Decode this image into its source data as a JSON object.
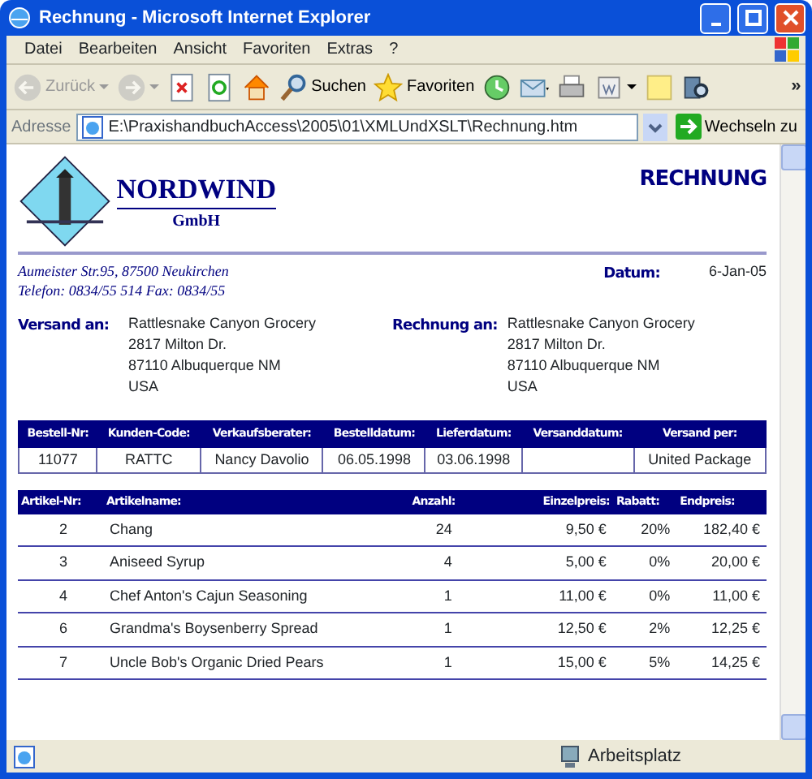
{
  "window": {
    "title": "Rechnung - Microsoft Internet Explorer"
  },
  "menu": [
    "Datei",
    "Bearbeiten",
    "Ansicht",
    "Favoriten",
    "Extras",
    "?"
  ],
  "toolbar": [
    {
      "kind": "back",
      "label": "Zurück",
      "disabled": true
    },
    {
      "kind": "forward",
      "disabled": true
    },
    {
      "kind": "stop",
      "disabled": false
    },
    {
      "kind": "refresh",
      "disabled": false
    },
    {
      "kind": "home",
      "disabled": false
    },
    {
      "kind": "search",
      "label": "Suchen",
      "disabled": false
    },
    {
      "kind": "favorites",
      "label": "Favoriten",
      "disabled": false
    },
    {
      "kind": "history",
      "disabled": false
    },
    {
      "kind": "mail",
      "disabled": false
    },
    {
      "kind": "print",
      "disabled": false
    },
    {
      "kind": "edit",
      "disabled": false
    },
    {
      "kind": "note",
      "disabled": false
    },
    {
      "kind": "research",
      "disabled": false
    }
  ],
  "toolbar_more": "»",
  "address": {
    "label": "Adresse",
    "url": "E:\\PraxishandbuchAccess\\2005\\01\\XMLUndXSLT\\Rechnung.htm",
    "go": "Wechseln zu"
  },
  "invoice": {
    "company": "NORDWIND",
    "company_suffix": "GmbH",
    "heading": "RECHNUNG",
    "sender_lines": [
      "Aumeister Str.95, 87500 Neukirchen",
      "Telefon:  0834/55 514 Fax:  0834/55"
    ],
    "date_label": "Datum:",
    "date": "6-Jan-05",
    "ship_to": {
      "label": "Versand an:",
      "lines": [
        "Rattlesnake Canyon Grocery",
        "2817 Milton Dr.",
        "87110 Albuquerque NM",
        "USA"
      ]
    },
    "bill_to": {
      "label": "Rechnung an:",
      "lines": [
        "Rattlesnake Canyon Grocery",
        "2817 Milton Dr.",
        "87110 Albuquerque NM",
        "USA"
      ]
    },
    "order_table": {
      "columns": [
        "Bestell-Nr:",
        "Kunden-Code:",
        "Verkaufsberater:",
        "Bestelldatum:",
        "Lieferdatum:",
        "Versanddatum:",
        "Versand per:"
      ],
      "rows": [
        [
          "11077",
          "RATTC",
          "Nancy Davolio",
          "06.05.1998",
          "03.06.1998",
          "",
          "United Package"
        ]
      ]
    },
    "items_table": {
      "columns": [
        "Artikel-Nr:",
        "Artikelname:",
        "Anzahl:",
        "Einzelpreis:",
        "Rabatt:",
        "Endpreis:"
      ],
      "rows": [
        [
          "2",
          "Chang",
          "24",
          "9,50 €",
          "20%",
          "182,40 €"
        ],
        [
          "3",
          "Aniseed Syrup",
          "4",
          "5,00 €",
          "0%",
          "20,00 €"
        ],
        [
          "4",
          "Chef Anton's Cajun Seasoning",
          "1",
          "11,00 €",
          "0%",
          "11,00 €"
        ],
        [
          "6",
          "Grandma's Boysenberry Spread",
          "1",
          "12,50 €",
          "2%",
          "12,25 €"
        ],
        [
          "7",
          "Uncle Bob's Organic Dried Pears",
          "1",
          "15,00 €",
          "5%",
          "14,25 €"
        ]
      ]
    }
  },
  "status_bar": {
    "zone": "Arbeitsplatz"
  }
}
